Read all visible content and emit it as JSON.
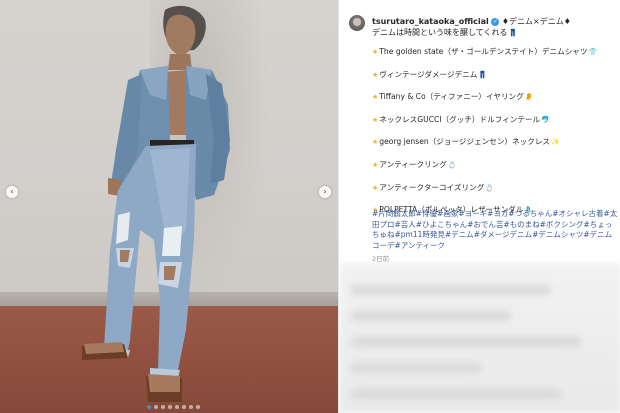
{
  "post": {
    "username": "tsurutaro_kataoka_official",
    "title_line": "♦デニム×デニム♦",
    "subtitle_line": "デニムは時間という味を醸してくれる",
    "items": [
      {
        "text": "The golden state（ザ・ゴールデンステイト）デニムシャツ",
        "emoji": "👕"
      },
      {
        "text": "ヴィンテージダメージデニム",
        "emoji": "👖"
      },
      {
        "text": "Tiffany & Co（ティファニー）イヤリング",
        "emoji": "👂"
      },
      {
        "text": "ネックレスGUCCI（グッチ）ドルフィンテール",
        "emoji": "🐬"
      },
      {
        "text": "georg jensen（ジョージジェンセン）ネックレス",
        "emoji": "✨"
      },
      {
        "text": "アンティークリング",
        "emoji": "💍"
      },
      {
        "text": "アンティークターコイズリング",
        "emoji": "💍"
      },
      {
        "text": "POLPETTA（ポルペッタ）レザーサンダル",
        "emoji": "🩴"
      }
    ],
    "hashtags": "#片岡鶴太郎#俳優#画家#ヨーギ#ヨガ#つるちゃん#オシャレ古着#太田プロ#芸人#ひよこちゃん#おでん芸#ものまね#ボクシング#ちょっちゅね#pm11時発見#デニム#ダメージデニム#デニムシャツ#デニムコーデ#アンティーク",
    "timestamp": "2日前"
  },
  "carousel": {
    "prev_glyph": "‹",
    "next_glyph": "›",
    "slide_count": 8,
    "active_index": 0
  }
}
